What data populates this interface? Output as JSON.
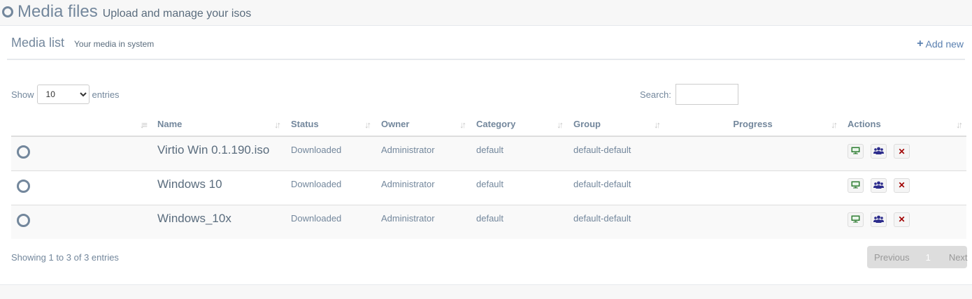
{
  "page": {
    "title": "Media files",
    "subtitle": "Upload and manage your isos"
  },
  "panel": {
    "title": "Media list",
    "subtitle": "Your media in system",
    "add_new": "Add new"
  },
  "controls": {
    "show_label": "Show",
    "entries_label": "entries",
    "page_length": "10",
    "search_label": "Search:",
    "search_value": ""
  },
  "table": {
    "columns": [
      "",
      "Name",
      "Status",
      "Owner",
      "Category",
      "Group",
      "Progress",
      "Actions"
    ],
    "rows": [
      {
        "name": "Virtio Win 0.1.190.iso",
        "status": "Downloaded",
        "owner": "Administrator",
        "category": "default",
        "group": "default-default",
        "progress": ""
      },
      {
        "name": "Windows 10",
        "status": "Downloaded",
        "owner": "Administrator",
        "category": "default",
        "group": "default-default",
        "progress": ""
      },
      {
        "name": "Windows_10x",
        "status": "Downloaded",
        "owner": "Administrator",
        "category": "default",
        "group": "default-default",
        "progress": ""
      }
    ],
    "row_actions": [
      "desktop-icon",
      "users-icon",
      "delete-icon"
    ]
  },
  "footer": {
    "info": "Showing 1 to 3 of 3 entries",
    "previous": "Previous",
    "current_page": "1",
    "next": "Next"
  },
  "colors": {
    "text": "#73879c",
    "accent": "#5a80b0",
    "desktop_icon": "#2e7d32",
    "users_icon": "#2c2c8c",
    "delete_icon": "#a00000"
  }
}
